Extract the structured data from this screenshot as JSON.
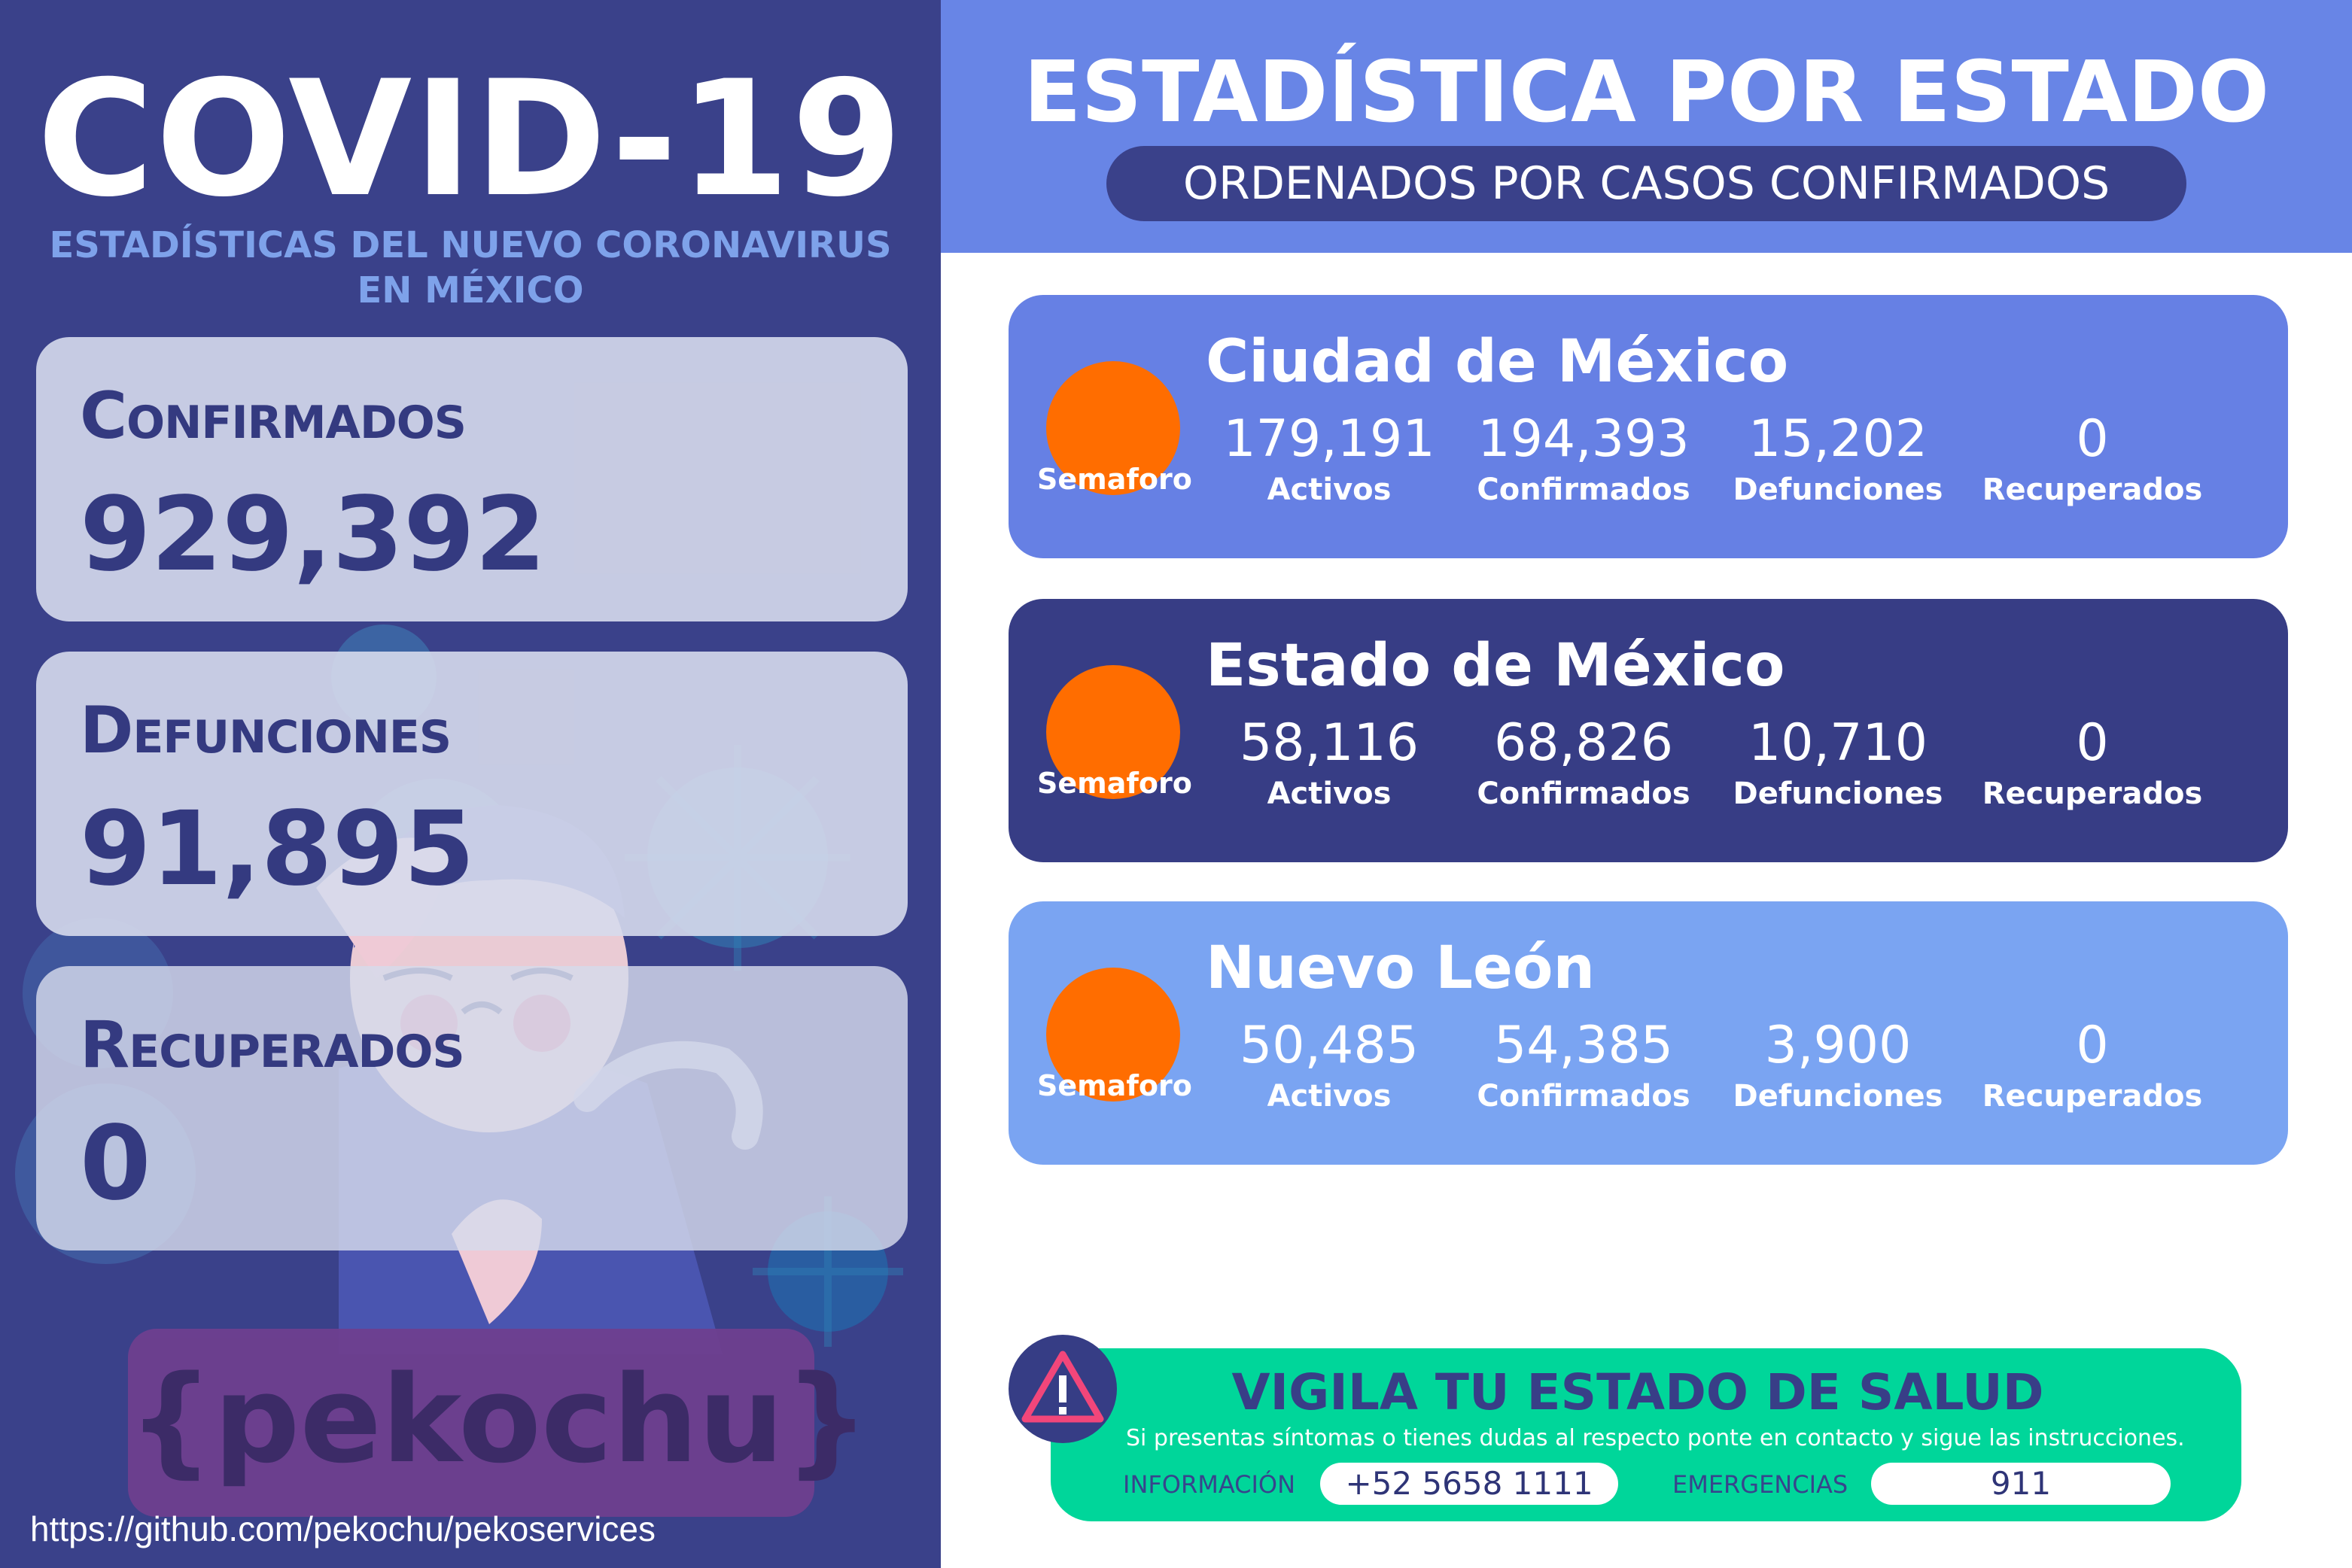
{
  "left_panel": {
    "title": "COVID-19",
    "subtitle": "ESTADÍSTICAS DEL NUEVO CORONAVIRUS EN MÉXICO",
    "stats": [
      {
        "label": "Confirmados",
        "value": "929,392"
      },
      {
        "label": "Defunciones",
        "value": "91,895"
      },
      {
        "label": "Recuperados",
        "value": "0"
      }
    ],
    "brand": "{pekochu}",
    "repo_url": "https://github.com/pekochu/pekoservices"
  },
  "header": {
    "title": "ESTADÍSTICA POR ESTADO",
    "subtitle": "ORDENADOS POR CASOS CONFIRMADOS"
  },
  "states": [
    {
      "name": "Ciudad de México",
      "semaforo_label": "Semaforo",
      "semaforo_color": "#ff6d00",
      "card_color": "#6680e4",
      "metrics": [
        {
          "value": "179,191",
          "label": "Activos"
        },
        {
          "value": "194,393",
          "label": "Confirmados"
        },
        {
          "value": "15,202",
          "label": "Defunciones"
        },
        {
          "value": "0",
          "label": "Recuperados"
        }
      ]
    },
    {
      "name": "Estado de México",
      "semaforo_label": "Semaforo",
      "semaforo_color": "#ff6d00",
      "card_color": "#373d85",
      "metrics": [
        {
          "value": "58,116",
          "label": "Activos"
        },
        {
          "value": "68,826",
          "label": "Confirmados"
        },
        {
          "value": "10,710",
          "label": "Defunciones"
        },
        {
          "value": "0",
          "label": "Recuperados"
        }
      ]
    },
    {
      "name": "Nuevo León",
      "semaforo_label": "Semaforo",
      "semaforo_color": "#ff6d00",
      "card_color": "#7aa4f2",
      "metrics": [
        {
          "value": "50,485",
          "label": "Activos"
        },
        {
          "value": "54,385",
          "label": "Confirmados"
        },
        {
          "value": "3,900",
          "label": "Defunciones"
        },
        {
          "value": "0",
          "label": "Recuperados"
        }
      ]
    }
  ],
  "salud": {
    "title": "VIGILA TU ESTADO DE SALUD",
    "body": "Si presentas síntomas o tienes dudas al respecto ponte en contacto y sigue las instrucciones.",
    "info_label": "INFORMACIÓN",
    "info_value": "+52 5658 1111",
    "emergency_label": "EMERGENCIAS",
    "emergency_value": "911",
    "icon": "warning-icon"
  },
  "colors": {
    "left_bg": "#3a418a",
    "header_bg": "#6885e6",
    "banner_bg": "#00d69a",
    "semaforo": "#ff6d00"
  }
}
